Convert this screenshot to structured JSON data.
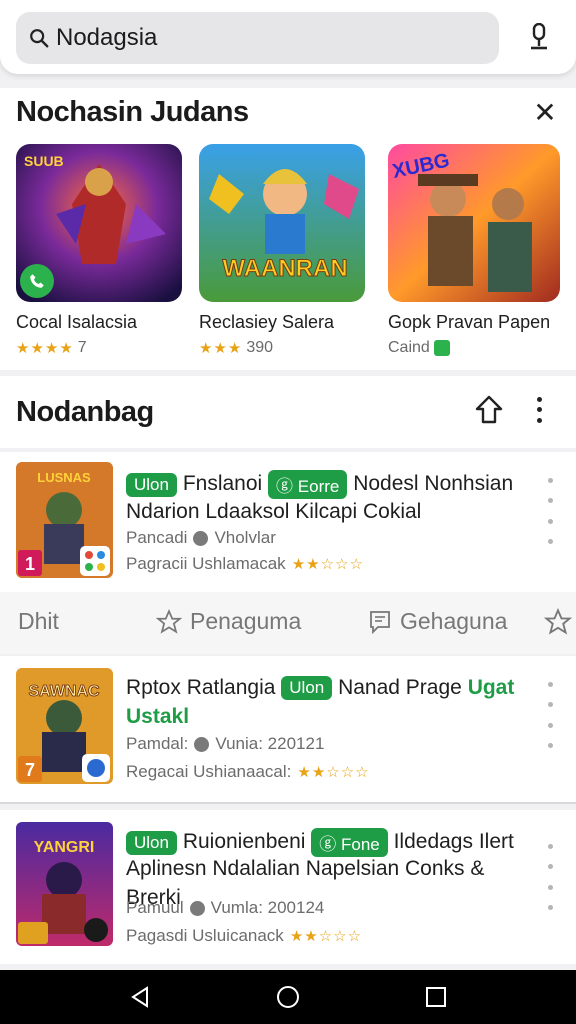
{
  "search": {
    "value": "Nodagsia"
  },
  "icons": {
    "search": "search-icon",
    "mic": "mic-icon",
    "close": "close-icon",
    "share": "share-icon",
    "more": "more-vert-icon"
  },
  "section1": {
    "title": "Nochasin Judans",
    "cards": [
      {
        "name": "Cocal Isalacsia",
        "stars": "★★★★",
        "sub": "7"
      },
      {
        "name": "Reclasiey Salera",
        "stars": "★★★",
        "sub": "390",
        "art_text": "WAANRAN"
      },
      {
        "name": "Gopk Pravan Papen",
        "stars": "",
        "sub": "Caind"
      }
    ]
  },
  "section2": {
    "title": "Nodanbag"
  },
  "items": [
    {
      "tag1": "Ulon",
      "line1": "Fnslanoi",
      "tag2": "Eorre",
      "line1b": "Nodesl Nonhsian",
      "line2": "Ndarion Ldaaksol Kilcapi Cokial",
      "meta1a": "Pancadi",
      "meta1b": "Vholvlar",
      "meta2": "Pagracii Ushlamacak",
      "stars": "★★☆☆☆",
      "badge": "1"
    },
    {
      "line1": "Rptox Ratlangia",
      "tag1": "Ulon",
      "line1b": "Nanad Prage",
      "green": "Ugat",
      "line2": "Ustakl",
      "meta1a": "Pamdal:",
      "meta1b": "Vunia: 220121",
      "meta2": "Regacai Ushianaacal:",
      "stars": "★★☆☆☆",
      "badge": "7",
      "art_text": "SAWNAC"
    },
    {
      "tag1": "Ulon",
      "line1": "Ruionienbeni",
      "tag2": "Fone",
      "line1b": "Ildedags Ilert",
      "line2": "Aplinesn Ndalalian Napelsian Conks &",
      "line3": "Brerki",
      "meta1a": "Pamuul",
      "meta1b": "Vumla: 200124",
      "meta2": "Pagasdi Usluicanack",
      "stars": "★★☆☆☆",
      "art_text": "YANGRI"
    }
  ],
  "actions": {
    "a1": "Dhit",
    "a2": "Penaguma",
    "a3": "Gehaguna"
  },
  "colors": {
    "accent_green": "#1f9d46",
    "star": "#e8a317"
  }
}
